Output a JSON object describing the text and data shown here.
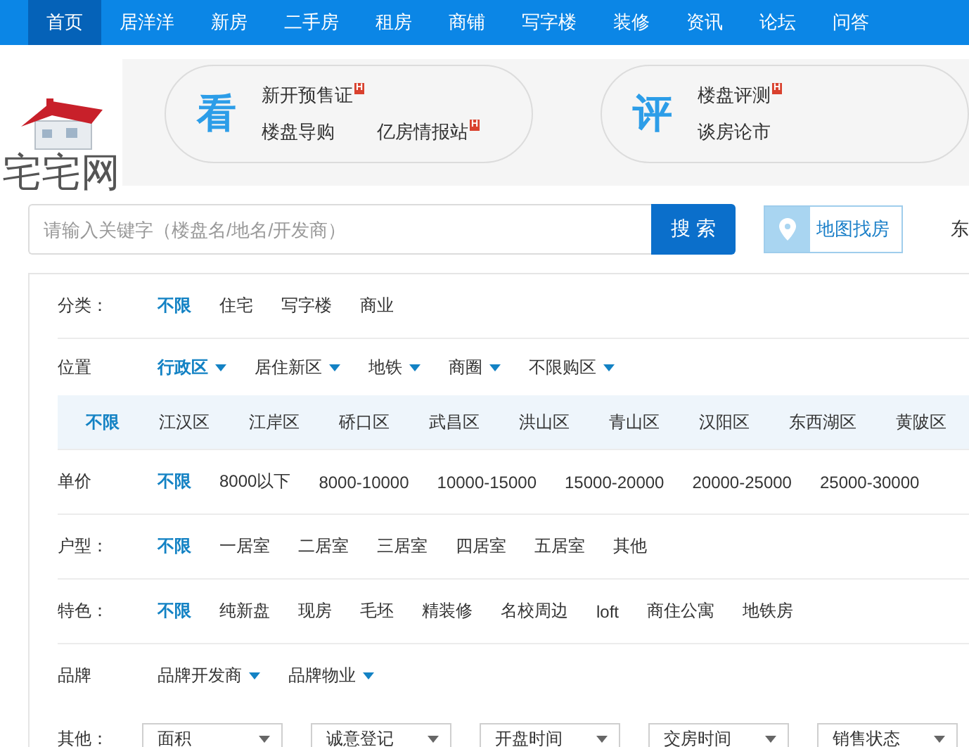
{
  "nav": [
    {
      "label": "首页",
      "selected": true
    },
    {
      "label": "居洋洋",
      "selected": false
    },
    {
      "label": "新房",
      "selected": false
    },
    {
      "label": "二手房",
      "selected": false
    },
    {
      "label": "租房",
      "selected": false
    },
    {
      "label": "商铺",
      "selected": false
    },
    {
      "label": "写字楼",
      "selected": false
    },
    {
      "label": "装修",
      "selected": false
    },
    {
      "label": "资讯",
      "selected": false
    },
    {
      "label": "论坛",
      "selected": false
    },
    {
      "label": "问答",
      "selected": false
    }
  ],
  "logo": {
    "text": "宅宅网"
  },
  "promo_cards": [
    {
      "icon_char": "看",
      "links": [
        {
          "text": "新开预售证",
          "badge": "H"
        },
        {
          "text": "楼盘导购"
        },
        {
          "text": "亿房情报站",
          "badge": "H"
        }
      ]
    },
    {
      "icon_char": "评",
      "links": [
        {
          "text": "楼盘评测",
          "badge": "H"
        },
        {
          "text": "谈房论市"
        }
      ]
    }
  ],
  "search": {
    "placeholder": "请输入关键字（楼盘名/地名/开发商）",
    "button": "搜 索",
    "map_button": "地图找房",
    "cut_text": "东"
  },
  "filters": [
    {
      "kind": "options",
      "label": "分类：",
      "options": [
        {
          "text": "不限",
          "selected": true
        },
        {
          "text": "住宅",
          "selected": false
        },
        {
          "text": "写字楼",
          "selected": false
        },
        {
          "text": "商业",
          "selected": false
        }
      ]
    },
    {
      "kind": "dropdowns",
      "label": "位置",
      "options": [
        {
          "text": "行政区",
          "selected": true
        },
        {
          "text": "居住新区",
          "selected": false
        },
        {
          "text": "地铁",
          "selected": false
        },
        {
          "text": "商圈",
          "selected": false
        },
        {
          "text": "不限购区",
          "selected": false
        }
      ],
      "sub_options": [
        {
          "text": "不限",
          "selected": true
        },
        {
          "text": "江汉区",
          "selected": false
        },
        {
          "text": "江岸区",
          "selected": false
        },
        {
          "text": "硚口区",
          "selected": false
        },
        {
          "text": "武昌区",
          "selected": false
        },
        {
          "text": "洪山区",
          "selected": false
        },
        {
          "text": "青山区",
          "selected": false
        },
        {
          "text": "汉阳区",
          "selected": false
        },
        {
          "text": "东西湖区",
          "selected": false
        },
        {
          "text": "黄陂区",
          "selected": false
        }
      ]
    },
    {
      "kind": "options",
      "label": "单价",
      "options": [
        {
          "text": "不限",
          "selected": true
        },
        {
          "text": "8000以下",
          "selected": false
        },
        {
          "text": "8000-10000",
          "selected": false
        },
        {
          "text": "10000-15000",
          "selected": false
        },
        {
          "text": "15000-20000",
          "selected": false
        },
        {
          "text": "20000-25000",
          "selected": false
        },
        {
          "text": "25000-30000",
          "selected": false
        }
      ]
    },
    {
      "kind": "options",
      "label": "户型：",
      "options": [
        {
          "text": "不限",
          "selected": true
        },
        {
          "text": "一居室",
          "selected": false
        },
        {
          "text": "二居室",
          "selected": false
        },
        {
          "text": "三居室",
          "selected": false
        },
        {
          "text": "四居室",
          "selected": false
        },
        {
          "text": "五居室",
          "selected": false
        },
        {
          "text": "其他",
          "selected": false
        }
      ]
    },
    {
      "kind": "options",
      "label": "特色：",
      "options": [
        {
          "text": "不限",
          "selected": true
        },
        {
          "text": "纯新盘",
          "selected": false
        },
        {
          "text": "现房",
          "selected": false
        },
        {
          "text": "毛坯",
          "selected": false
        },
        {
          "text": "精装修",
          "selected": false
        },
        {
          "text": "名校周边",
          "selected": false
        },
        {
          "text": "loft",
          "selected": false
        },
        {
          "text": "商住公寓",
          "selected": false
        },
        {
          "text": "地铁房",
          "selected": false
        }
      ]
    },
    {
      "kind": "dropdowns",
      "label": "品牌",
      "options": [
        {
          "text": "品牌开发商",
          "selected": false
        },
        {
          "text": "品牌物业",
          "selected": false
        }
      ]
    },
    {
      "kind": "selects",
      "label": "其他：",
      "options": [
        {
          "text": "面积"
        },
        {
          "text": "诚意登记"
        },
        {
          "text": "开盘时间"
        },
        {
          "text": "交房时间"
        },
        {
          "text": "销售状态"
        }
      ]
    }
  ]
}
